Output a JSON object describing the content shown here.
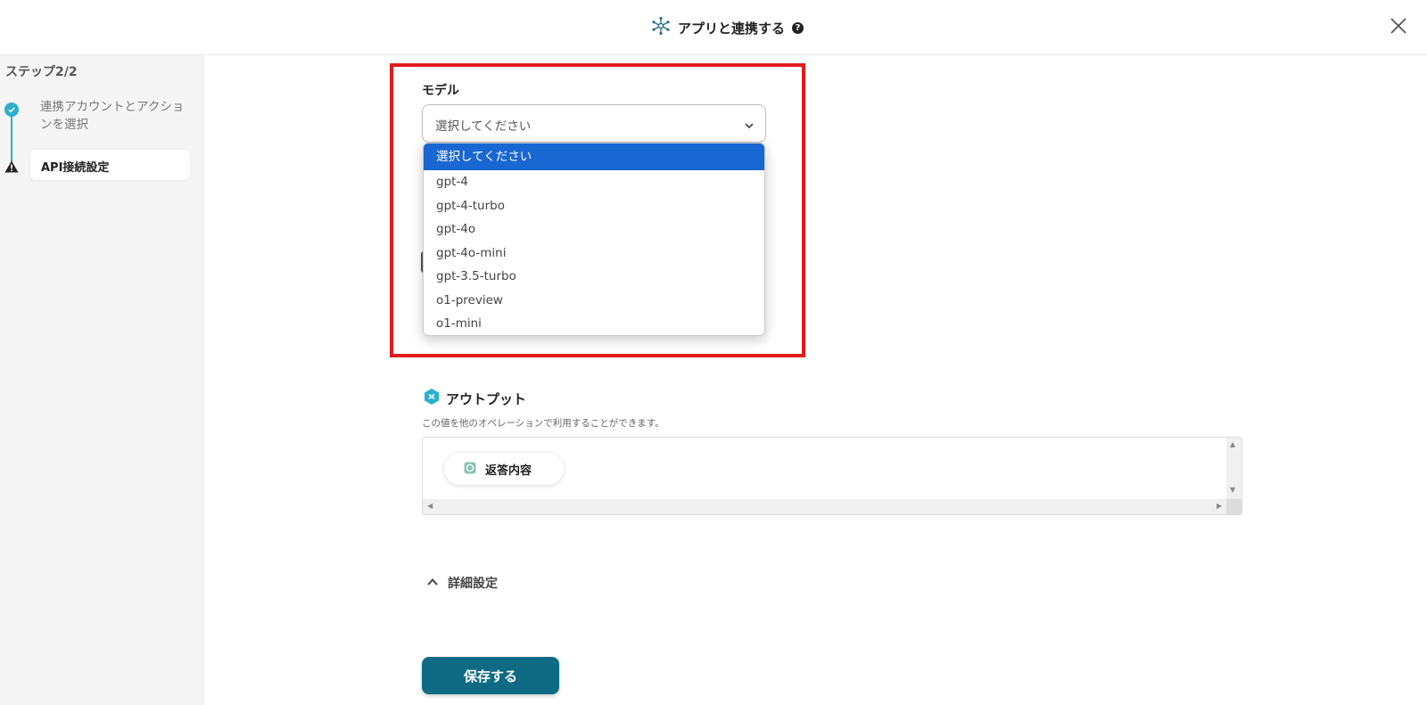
{
  "header": {
    "title": "アプリと連携する",
    "help_icon": "?",
    "close_icon": "close-icon"
  },
  "sidebar": {
    "step_label": "ステップ2/2",
    "steps": [
      {
        "label": "連携アカウントとアクションを選択",
        "status": "done"
      },
      {
        "label": "API接続設定",
        "status": "warning"
      }
    ]
  },
  "model_field": {
    "label": "モデル",
    "selected_value": "選択してください",
    "options": [
      "選択してください",
      "gpt-4",
      "gpt-4-turbo",
      "gpt-4o",
      "gpt-4o-mini",
      "gpt-3.5-turbo",
      "o1-preview",
      "o1-mini"
    ]
  },
  "output": {
    "title": "アウトプット",
    "description": "この値を他のオペレーションで利用することができます。",
    "chips": [
      "返答内容"
    ]
  },
  "advanced": {
    "label": "詳細設定"
  },
  "save_button": {
    "label": "保存する"
  },
  "colors": {
    "accent": "#2bb0c9",
    "primary_button": "#0f6b84",
    "selected_option": "#1967d2",
    "highlight_border": "#e21b1b"
  }
}
